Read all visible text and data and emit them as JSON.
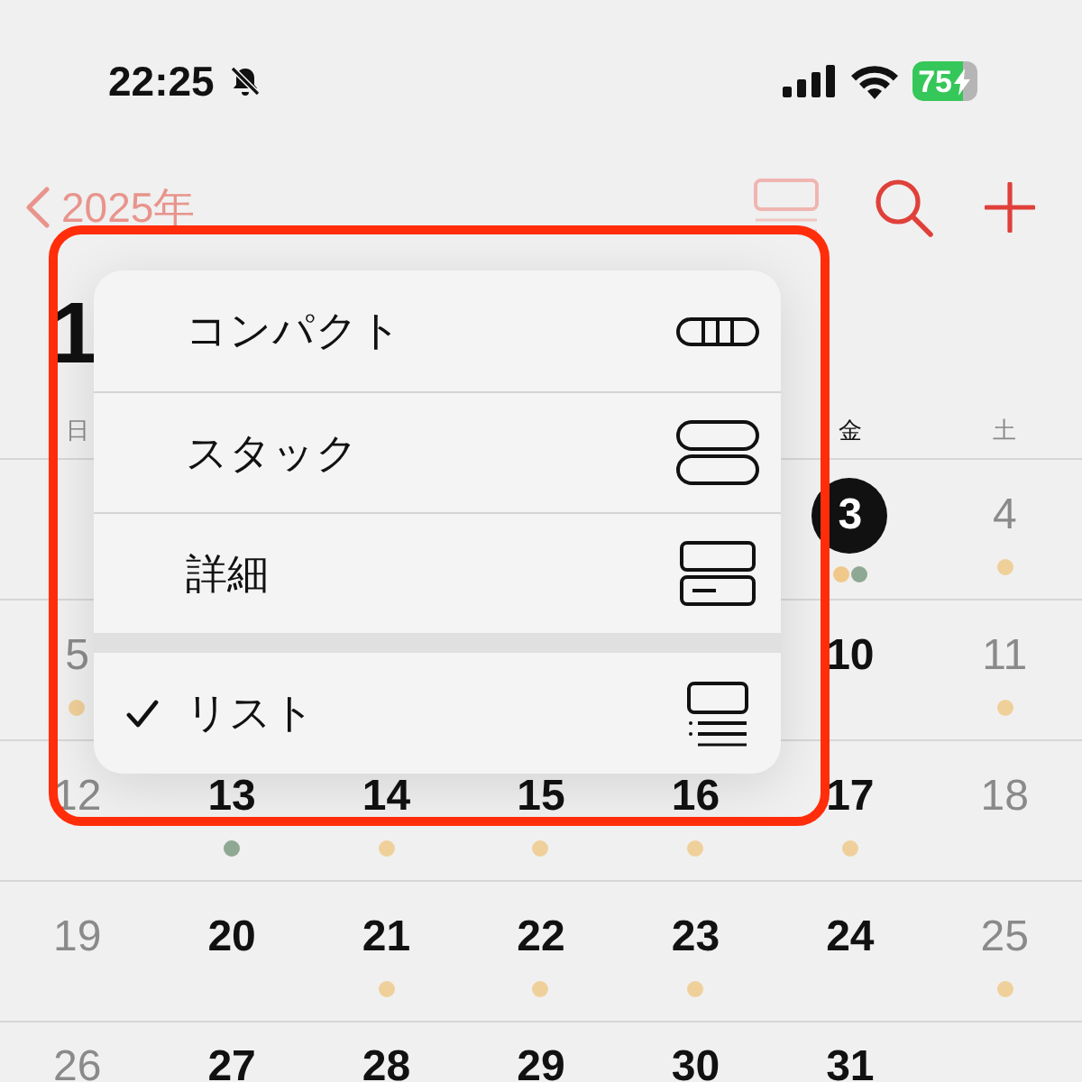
{
  "status_bar": {
    "time": "22:25",
    "battery": "75"
  },
  "nav": {
    "back_label": "2025年"
  },
  "month_title": "1",
  "weekdays": {
    "sun": "日",
    "fri": "金",
    "sat": "土"
  },
  "weeks": [
    {
      "fri": {
        "day": "3",
        "today": true,
        "events": [
          {
            "color": "#f0c98a"
          },
          {
            "color": "#8fa893"
          }
        ]
      },
      "sat": {
        "day": "4",
        "today": false,
        "events": [
          {
            "color": "#f0d09a"
          }
        ]
      }
    },
    {
      "sun": {
        "day": "5",
        "today": false,
        "events": [
          {
            "color": "#f0d09a"
          }
        ]
      },
      "fri": {
        "day": "10",
        "today": false
      },
      "sat": {
        "day": "11",
        "today": false,
        "events": [
          {
            "color": "#f0d09a"
          }
        ]
      }
    },
    {
      "sun": {
        "day": "12",
        "today": false
      },
      "mon": {
        "day": "13",
        "today": false,
        "events": [
          {
            "color": "#8fa893"
          }
        ]
      },
      "tue": {
        "day": "14",
        "today": false,
        "events": [
          {
            "color": "#f0d09a"
          }
        ]
      },
      "wed": {
        "day": "15",
        "today": false,
        "events": [
          {
            "color": "#f0d09a"
          }
        ]
      },
      "thu": {
        "day": "16",
        "today": false,
        "events": [
          {
            "color": "#f0d09a"
          }
        ]
      },
      "fri": {
        "day": "17",
        "today": false,
        "events": [
          {
            "color": "#f0d09a"
          }
        ]
      },
      "sat": {
        "day": "18",
        "today": false
      }
    },
    {
      "sun": {
        "day": "19",
        "today": false
      },
      "mon": {
        "day": "20",
        "today": false
      },
      "tue": {
        "day": "21",
        "today": false,
        "events": [
          {
            "color": "#f0d09a"
          }
        ]
      },
      "wed": {
        "day": "22",
        "today": false,
        "events": [
          {
            "color": "#f0d09a"
          }
        ]
      },
      "thu": {
        "day": "23",
        "today": false,
        "events": [
          {
            "color": "#f0d09a"
          }
        ]
      },
      "fri": {
        "day": "24",
        "today": false
      },
      "sat": {
        "day": "25",
        "today": false,
        "events": [
          {
            "color": "#f0d09a"
          }
        ]
      }
    },
    {
      "sun": {
        "day": "26",
        "today": false
      },
      "mon": {
        "day": "27",
        "today": false
      },
      "tue": {
        "day": "28",
        "today": false
      },
      "wed": {
        "day": "29",
        "today": false
      },
      "thu": {
        "day": "30",
        "today": false
      },
      "fri": {
        "day": "31",
        "today": false
      }
    }
  ],
  "view_menu": {
    "sections": [
      [
        {
          "label": "コンパクト",
          "kind": "compact",
          "selected": false
        },
        {
          "label": "スタック",
          "kind": "stack",
          "selected": false
        },
        {
          "label": "詳細",
          "kind": "detail",
          "selected": false
        }
      ],
      [
        {
          "label": "リスト",
          "kind": "list",
          "selected": true
        }
      ]
    ]
  }
}
